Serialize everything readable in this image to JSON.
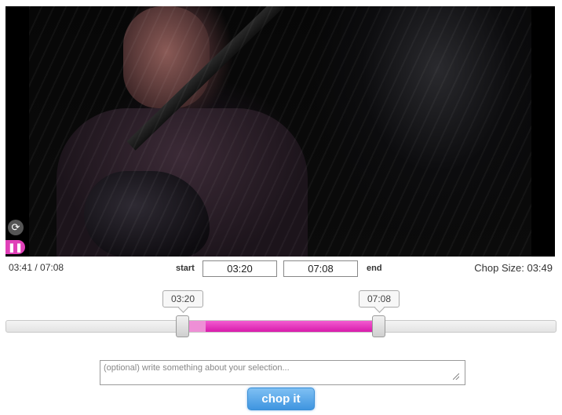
{
  "player": {
    "current_time": "03:41",
    "duration": "07:08",
    "time_display": "03:41 / 07:08",
    "progress_fraction": 0.516,
    "state": "playing",
    "accent_color": "#e040b8"
  },
  "selection": {
    "start_label": "start",
    "end_label": "end",
    "start_value": "03:20",
    "end_value": "07:08",
    "chop_size_text": "Chop Size: 03:49",
    "bubble_start": "03:20",
    "bubble_end": "07:08",
    "selection_color": "#e02cbf"
  },
  "note": {
    "placeholder": "(optional) write something about your selection...",
    "value": ""
  },
  "action": {
    "chop_label": "chop it",
    "button_color": "#4a9be3"
  },
  "icons": {
    "replay": "refresh-icon",
    "pause": "pause-icon"
  }
}
